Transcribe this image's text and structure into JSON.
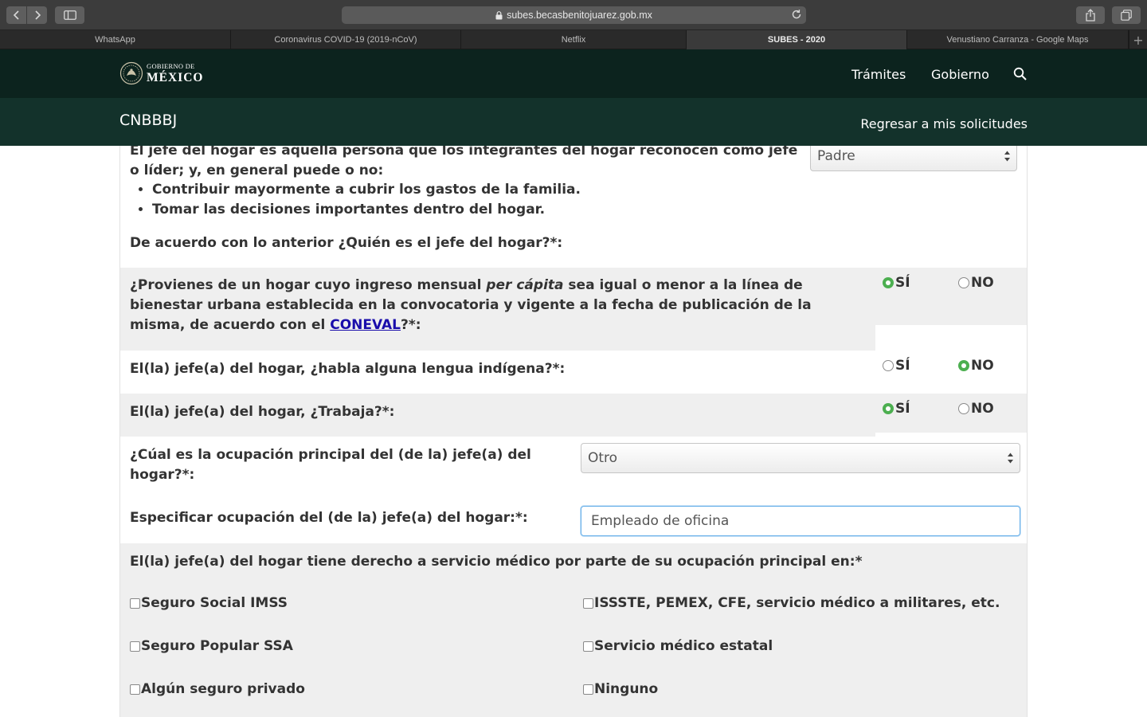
{
  "browser": {
    "url": "subes.becasbenitojuarez.gob.mx",
    "tabs": [
      {
        "label": "WhatsApp",
        "active": false
      },
      {
        "label": "Coronavirus COVID-19 (2019-nCoV)",
        "active": false
      },
      {
        "label": "Netflix",
        "active": false
      },
      {
        "label": "SUBES - 2020",
        "active": true
      },
      {
        "label": "Venustiano Carranza - Google Maps",
        "active": false
      }
    ]
  },
  "header": {
    "logo_top": "GOBIERNO DE",
    "logo_main": "MÉXICO",
    "nav": {
      "tramites": "Trámites",
      "gobierno": "Gobierno"
    }
  },
  "subheader": {
    "title": "CNBBBJ",
    "back_link": "Regresar a mis solicitudes"
  },
  "form": {
    "jefe": {
      "intro": "El jefe del hogar es aquella persona que los integrantes del hogar reconocen como jefe o líder; y, en general puede o no:",
      "bullets": [
        "Contribuir mayormente a cubrir los gastos de la familia.",
        "Tomar las decisiones importantes dentro del hogar."
      ],
      "question": "De acuerdo con lo anterior ¿Quién es el jefe del hogar?*:",
      "selected": "Padre"
    },
    "ingreso": {
      "q_part1": "¿Provienes de un hogar cuyo ingreso mensual ",
      "q_italic": "per cápita",
      "q_part2": " sea igual o menor a la línea de bienestar urbana establecida en la convocatoria y vigente a la fecha de publicación de la misma, de acuerdo con el ",
      "q_link": "CONEVAL",
      "q_part3": "?*:",
      "yes": "SÍ",
      "no": "NO",
      "value": "SÍ"
    },
    "lengua": {
      "question": "El(la) jefe(a) del hogar, ¿habla alguna lengua indígena?*:",
      "yes": "SÍ",
      "no": "NO",
      "value": "NO"
    },
    "trabaja": {
      "question": "El(la) jefe(a) del hogar, ¿Trabaja?*:",
      "yes": "SÍ",
      "no": "NO",
      "value": "SÍ"
    },
    "ocupacion": {
      "question": "¿Cúal es la ocupación principal del (de la) jefe(a) del hogar?*:",
      "selected": "Otro"
    },
    "especificar": {
      "question": "Especificar ocupación del (de la) jefe(a) del hogar:*:",
      "value": "Empleado de oficina"
    },
    "servicio": {
      "question": "El(la) jefe(a) del hogar tiene derecho a servicio médico por parte de su ocupación principal en:*",
      "options": [
        "Seguro Social IMSS",
        "ISSSTE, PEMEX, CFE, servicio médico a militares, etc.",
        "Seguro Popular SSA",
        "Servicio médico estatal",
        "Algún seguro privado",
        "Ninguno"
      ]
    }
  },
  "colors": {
    "header_dark": "#0c231e",
    "subheader": "#13322b",
    "radio_selected": "#4caf50",
    "row_gray": "#efefef",
    "link": "#1a0dab"
  }
}
